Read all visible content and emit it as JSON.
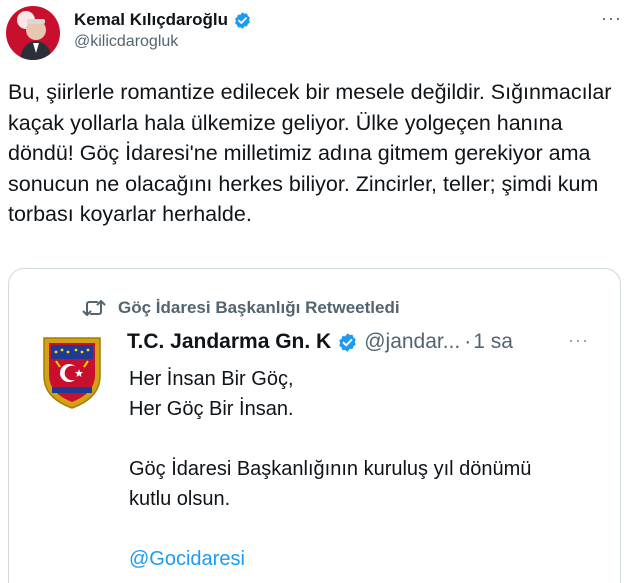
{
  "author": {
    "name": "Kemal Kılıçdaroğlu",
    "handle": "@kilicdarogluk"
  },
  "tweet": {
    "text": "Bu, şiirlerle romantize edilecek bir mesele değildir. Sığınmacılar kaçak yollarla hala ülkemize geliyor. Ülke yolgeçen hanına döndü! Göç İdaresi'ne milletimiz adına gitmem gerekiyor ama sonucun ne olacağını herkes biliyor. Zincirler, teller; şimdi kum torbası koyarlar herhalde."
  },
  "more_label": "···",
  "quote": {
    "retweet_label": "Göç İdaresi Başkanlığı Retweetledi",
    "name": "T.C. Jandarma Gn. K",
    "handle": "@jandar...",
    "separator": "·",
    "time": "1 sa",
    "more_label": "···",
    "lines": [
      "Her İnsan Bir Göç,",
      "Her Göç Bir İnsan."
    ],
    "paragraph2": [
      "Göç İdaresi Başkanlığının kuruluş yıl dönümü",
      "kutlu olsun."
    ],
    "link": "@Gocidaresi"
  },
  "colors": {
    "verified": "#1d9bf0",
    "link": "#1d9bf0",
    "secondary_text": "#536471",
    "border": "#cfd9de"
  },
  "icons": {
    "verified": "verified-badge-icon",
    "retweet": "retweet-icon",
    "more": "more-options-icon"
  }
}
